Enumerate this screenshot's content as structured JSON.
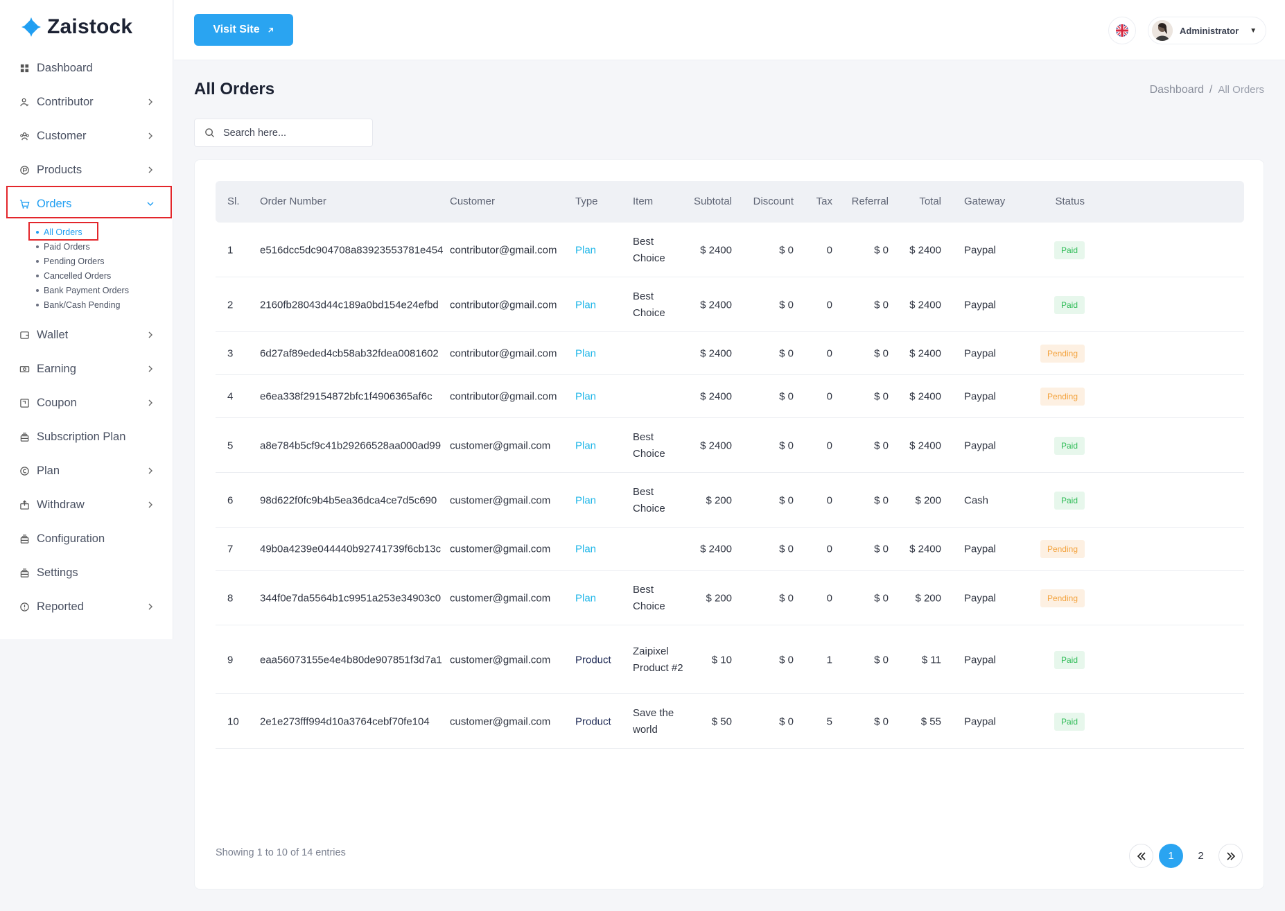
{
  "brand": {
    "name": "Zaistock",
    "accent": "#1f9ef2"
  },
  "sidebar": {
    "items": [
      {
        "label": "Dashboard",
        "icon": "grid-icon",
        "has_children": false
      },
      {
        "label": "Contributor",
        "icon": "contributor-icon",
        "has_children": true
      },
      {
        "label": "Customer",
        "icon": "users-icon",
        "has_children": true
      },
      {
        "label": "Products",
        "icon": "product-icon",
        "has_children": true
      },
      {
        "label": "Orders",
        "icon": "cart-icon",
        "has_children": true,
        "expanded": true,
        "active": true
      }
    ],
    "orders_submenu": [
      {
        "label": "All Orders",
        "active": true
      },
      {
        "label": "Paid Orders"
      },
      {
        "label": "Pending Orders"
      },
      {
        "label": "Cancelled Orders"
      },
      {
        "label": "Bank Payment Orders"
      },
      {
        "label": "Bank/Cash Pending"
      }
    ],
    "items_after": [
      {
        "label": "Wallet",
        "icon": "wallet-icon",
        "has_children": true
      },
      {
        "label": "Earning",
        "icon": "money-icon",
        "has_children": true
      },
      {
        "label": "Coupon",
        "icon": "coupon-icon",
        "has_children": true
      },
      {
        "label": "Subscription Plan",
        "icon": "stack-icon",
        "has_children": false
      },
      {
        "label": "Plan",
        "icon": "plan-icon",
        "has_children": true
      },
      {
        "label": "Withdraw",
        "icon": "withdraw-icon",
        "has_children": true
      },
      {
        "label": "Configuration",
        "icon": "stack-icon",
        "has_children": false
      },
      {
        "label": "Settings",
        "icon": "stack-icon",
        "has_children": false
      },
      {
        "label": "Reported",
        "icon": "alert-icon",
        "has_children": true
      }
    ]
  },
  "topbar": {
    "visit_label": "Visit Site",
    "language_icon": "uk-flag-icon",
    "user_name": "Administrator"
  },
  "page": {
    "title": "All Orders",
    "breadcrumb": [
      "Dashboard",
      "All Orders"
    ],
    "search_placeholder": "Search here..."
  },
  "table": {
    "columns": [
      "Sl.",
      "Order Number",
      "Customer",
      "Type",
      "Item",
      "Subtotal",
      "Discount",
      "Tax",
      "Referral",
      "Total",
      "Gateway",
      "Status"
    ],
    "rows": [
      {
        "sl": "1",
        "order": "e516dcc5dc904708a83923553781e454",
        "customer": "contributor@gmail.com",
        "type": "Plan",
        "item": "Best Choice",
        "subtotal": "$ 2400",
        "discount": "$ 0",
        "tax": "0",
        "referral": "$ 0",
        "total": "$ 2400",
        "gateway": "Paypal",
        "status": "Paid"
      },
      {
        "sl": "2",
        "order": "2160fb28043d44c189a0bd154e24efbd",
        "customer": "contributor@gmail.com",
        "type": "Plan",
        "item": "Best Choice",
        "subtotal": "$ 2400",
        "discount": "$ 0",
        "tax": "0",
        "referral": "$ 0",
        "total": "$ 2400",
        "gateway": "Paypal",
        "status": "Paid"
      },
      {
        "sl": "3",
        "order": "6d27af89eded4cb58ab32fdea0081602",
        "customer": "contributor@gmail.com",
        "type": "Plan",
        "item": "",
        "subtotal": "$ 2400",
        "discount": "$ 0",
        "tax": "0",
        "referral": "$ 0",
        "total": "$ 2400",
        "gateway": "Paypal",
        "status": "Pending"
      },
      {
        "sl": "4",
        "order": "e6ea338f29154872bfc1f4906365af6c",
        "customer": "contributor@gmail.com",
        "type": "Plan",
        "item": "",
        "subtotal": "$ 2400",
        "discount": "$ 0",
        "tax": "0",
        "referral": "$ 0",
        "total": "$ 2400",
        "gateway": "Paypal",
        "status": "Pending"
      },
      {
        "sl": "5",
        "order": "a8e784b5cf9c41b29266528aa000ad99",
        "customer": "customer@gmail.com",
        "type": "Plan",
        "item": "Best Choice",
        "subtotal": "$ 2400",
        "discount": "$ 0",
        "tax": "0",
        "referral": "$ 0",
        "total": "$ 2400",
        "gateway": "Paypal",
        "status": "Paid"
      },
      {
        "sl": "6",
        "order": "98d622f0fc9b4b5ea36dca4ce7d5c690",
        "customer": "customer@gmail.com",
        "type": "Plan",
        "item": "Best Choice",
        "subtotal": "$ 200",
        "discount": "$ 0",
        "tax": "0",
        "referral": "$ 0",
        "total": "$ 200",
        "gateway": "Cash",
        "status": "Paid"
      },
      {
        "sl": "7",
        "order": "49b0a4239e044440b92741739f6cb13c",
        "customer": "customer@gmail.com",
        "type": "Plan",
        "item": "",
        "subtotal": "$ 2400",
        "discount": "$ 0",
        "tax": "0",
        "referral": "$ 0",
        "total": "$ 2400",
        "gateway": "Paypal",
        "status": "Pending"
      },
      {
        "sl": "8",
        "order": "344f0e7da5564b1c9951a253e34903c0",
        "customer": "customer@gmail.com",
        "type": "Plan",
        "item": "Best Choice",
        "subtotal": "$ 200",
        "discount": "$ 0",
        "tax": "0",
        "referral": "$ 0",
        "total": "$ 200",
        "gateway": "Paypal",
        "status": "Pending"
      },
      {
        "sl": "9",
        "order": "eaa56073155e4e4b80de907851f3d7a1",
        "customer": "customer@gmail.com",
        "type": "Product",
        "item": "Zaipixel Product #2",
        "subtotal": "$ 10",
        "discount": "$ 0",
        "tax": "1",
        "referral": "$ 0",
        "total": "$ 11",
        "gateway": "Paypal",
        "status": "Paid"
      },
      {
        "sl": "10",
        "order": "2e1e273fff994d10a3764cebf70fe104",
        "customer": "customer@gmail.com",
        "type": "Product",
        "item": "Save the world",
        "subtotal": "$ 50",
        "discount": "$ 0",
        "tax": "5",
        "referral": "$ 0",
        "total": "$ 55",
        "gateway": "Paypal",
        "status": "Paid"
      }
    ]
  },
  "footer": {
    "showing": "Showing 1 to 10 of 14 entries",
    "pages": [
      "1",
      "2"
    ],
    "current_page": "1"
  },
  "colors": {
    "paid": "#2dbb55",
    "pending": "#f3a23c",
    "plan": "#1fb6e8",
    "primary_button": "#2aa4f1",
    "highlight_box": "#e3262b"
  }
}
